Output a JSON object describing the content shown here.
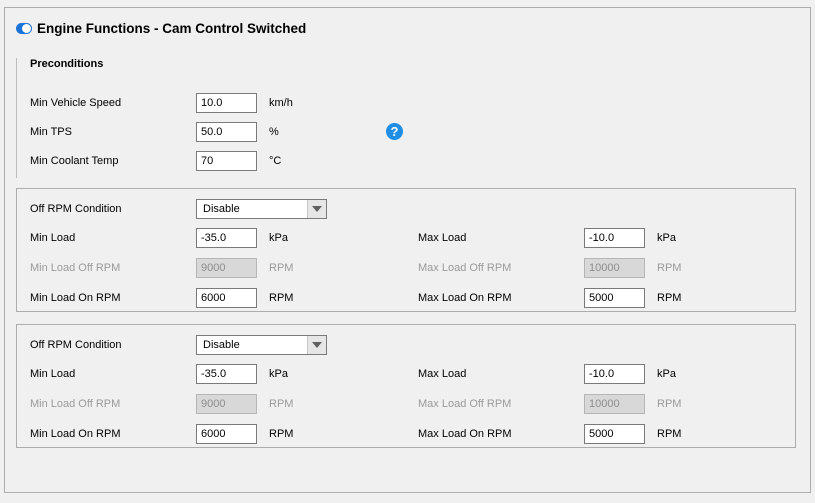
{
  "header": {
    "title": "Engine Functions - Cam Control Switched"
  },
  "preconditions": {
    "heading": "Preconditions",
    "rows": [
      {
        "label": "Min Vehicle Speed",
        "value": "10.0",
        "unit": "km/h"
      },
      {
        "label": "Min TPS",
        "value": "50.0",
        "unit": "%"
      },
      {
        "label": "Min Coolant Temp",
        "value": "70",
        "unit": "°C"
      }
    ],
    "help_icon": "?"
  },
  "groups": [
    {
      "condition_label": "Off RPM Condition",
      "condition_value": "Disable",
      "min_load": {
        "label": "Min Load",
        "value": "-35.0",
        "unit": "kPa"
      },
      "max_load": {
        "label": "Max Load",
        "value": "-10.0",
        "unit": "kPa"
      },
      "min_load_off_rpm": {
        "label": "Min Load Off RPM",
        "value": "9000",
        "unit": "RPM"
      },
      "max_load_off_rpm": {
        "label": "Max Load Off RPM",
        "value": "10000",
        "unit": "RPM"
      },
      "min_load_on_rpm": {
        "label": "Min Load On RPM",
        "value": "6000",
        "unit": "RPM"
      },
      "max_load_on_rpm": {
        "label": "Max Load On RPM",
        "value": "5000",
        "unit": "RPM"
      }
    },
    {
      "condition_label": "Off RPM Condition",
      "condition_value": "Disable",
      "min_load": {
        "label": "Min Load",
        "value": "-35.0",
        "unit": "kPa"
      },
      "max_load": {
        "label": "Max Load",
        "value": "-10.0",
        "unit": "kPa"
      },
      "min_load_off_rpm": {
        "label": "Min Load Off RPM",
        "value": "9000",
        "unit": "RPM"
      },
      "max_load_off_rpm": {
        "label": "Max Load Off RPM",
        "value": "10000",
        "unit": "RPM"
      },
      "min_load_on_rpm": {
        "label": "Min Load On RPM",
        "value": "6000",
        "unit": "RPM"
      },
      "max_load_on_rpm": {
        "label": "Max Load On RPM",
        "value": "5000",
        "unit": "RPM"
      }
    }
  ]
}
